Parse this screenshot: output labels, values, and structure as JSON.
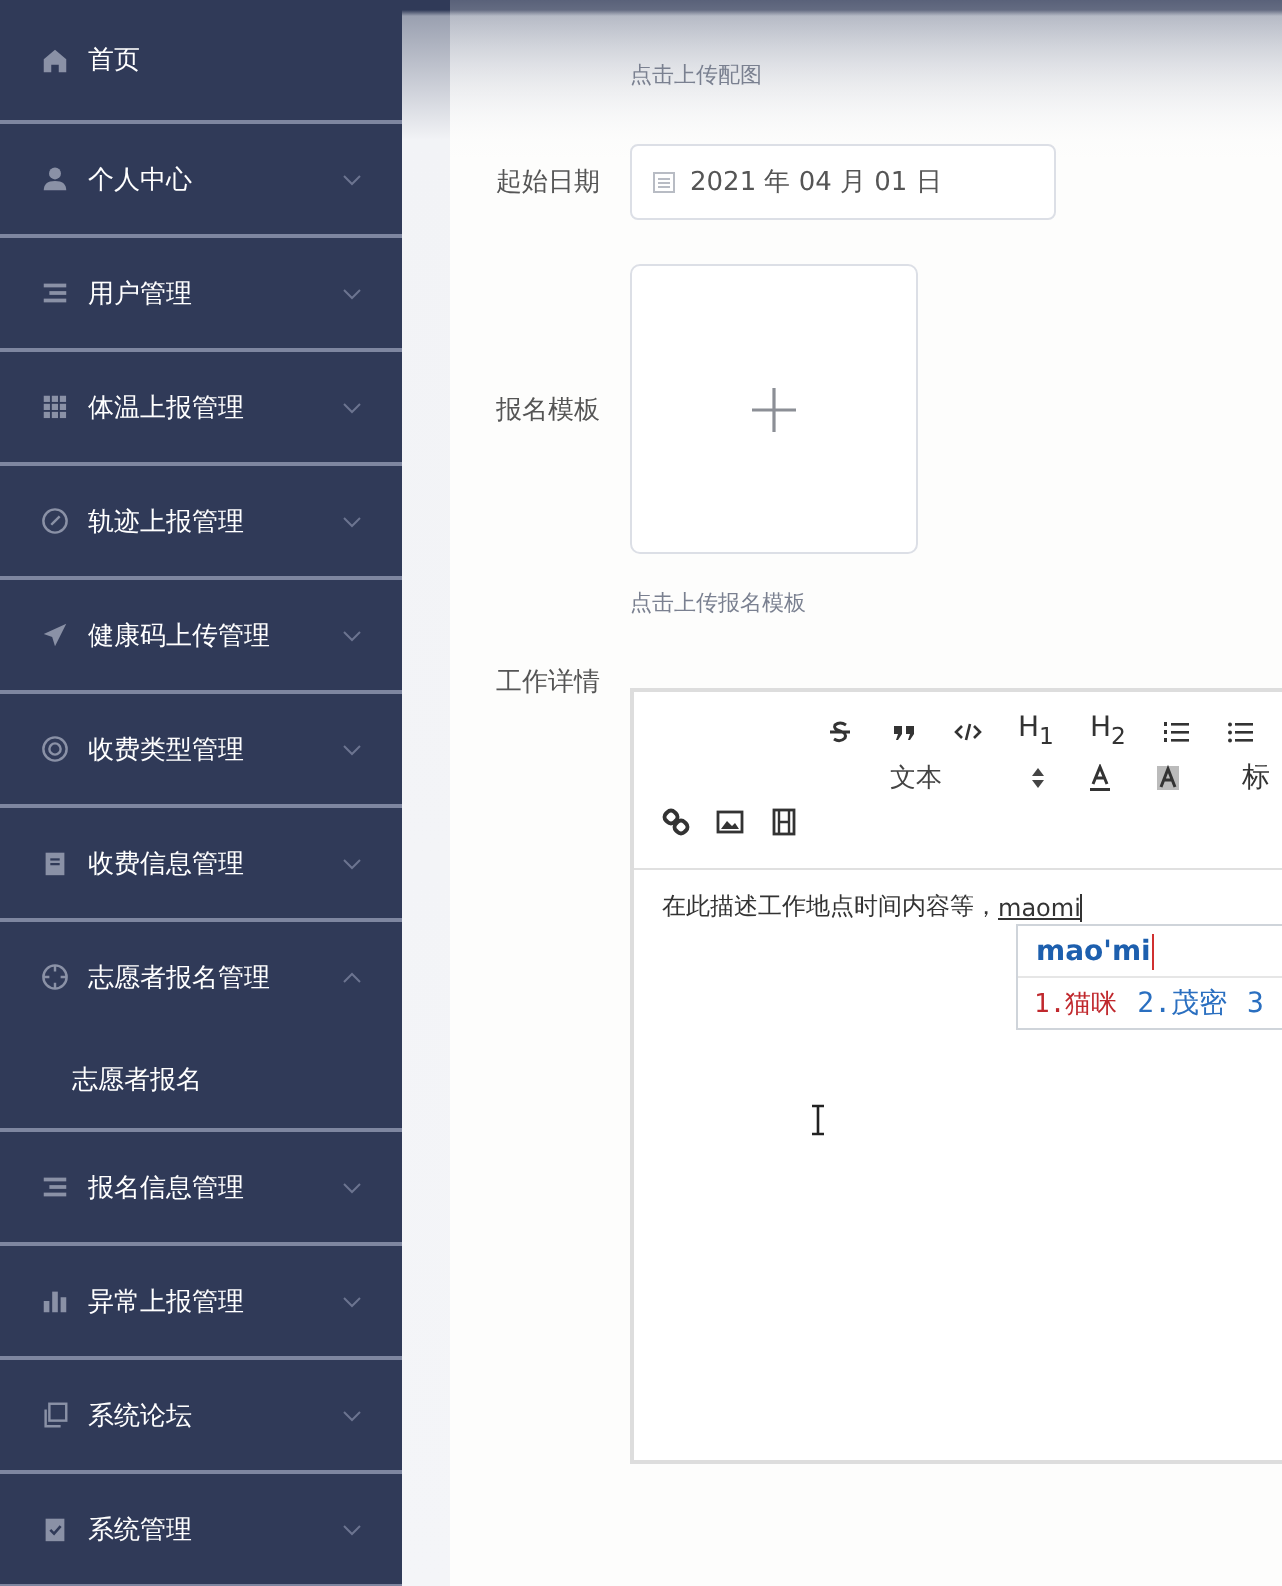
{
  "sidebar": {
    "items": [
      {
        "label": "首页",
        "expandable": false
      },
      {
        "label": "个人中心",
        "expandable": true,
        "expanded": false
      },
      {
        "label": "用户管理",
        "expandable": true,
        "expanded": false
      },
      {
        "label": "体温上报管理",
        "expandable": true,
        "expanded": false
      },
      {
        "label": "轨迹上报管理",
        "expandable": true,
        "expanded": false
      },
      {
        "label": "健康码上传管理",
        "expandable": true,
        "expanded": false
      },
      {
        "label": "收费类型管理",
        "expandable": true,
        "expanded": false
      },
      {
        "label": "收费信息管理",
        "expandable": true,
        "expanded": false
      },
      {
        "label": "志愿者报名管理",
        "expandable": true,
        "expanded": true,
        "children": [
          {
            "label": "志愿者报名"
          }
        ]
      },
      {
        "label": "报名信息管理",
        "expandable": true,
        "expanded": false
      },
      {
        "label": "异常上报管理",
        "expandable": true,
        "expanded": false
      },
      {
        "label": "系统论坛",
        "expandable": true,
        "expanded": false
      },
      {
        "label": "系统管理",
        "expandable": true,
        "expanded": false
      }
    ]
  },
  "form": {
    "image_hint": "点击上传配图",
    "start_date": {
      "label": "起始日期",
      "value": "2021 年 04 月 01 日"
    },
    "template": {
      "label": "报名模板",
      "hint": "点击上传报名模板"
    },
    "details": {
      "label": "工作详情",
      "toolbar_row1": [
        {
          "kind": "icon"
        },
        {
          "kind": "icon"
        },
        {
          "kind": "icon"
        },
        {
          "kind": "text",
          "text": "H$_{1}$"
        },
        {
          "kind": "text",
          "text": "H$_{2}$"
        },
        {
          "kind": "icon"
        },
        {
          "kind": "icon"
        }
      ],
      "toolbar_row2": [
        {
          "kind": "select",
          "text": "文本"
        },
        {
          "kind": "icon"
        },
        {
          "kind": "icon"
        },
        {
          "kind": "text",
          "text": "标"
        }
      ],
      "content": "在此描述工作地点时间内容等，",
      "composing": "maomi",
      "ime": {
        "pinyin": "mao'mi",
        "candidates": [
          {
            "text": "1.猫咪",
            "selected": true
          },
          {
            "text": "2.茂密",
            "selected": false
          },
          {
            "text": "3",
            "selected": false
          }
        ]
      }
    }
  }
}
